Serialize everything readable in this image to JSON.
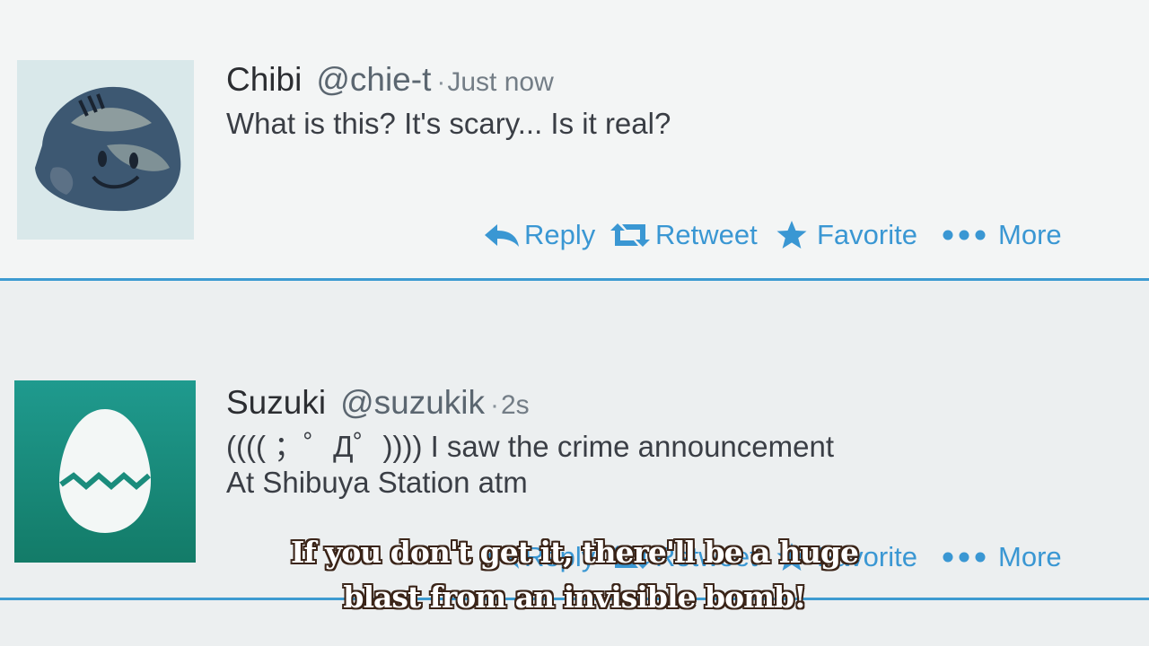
{
  "tweets": [
    {
      "avatar_icon": "rock-face-avatar",
      "name": "Chibi",
      "handle": "@chie-t",
      "separator": "·",
      "time": "Just now",
      "lines": [
        "What is this? It's scary... Is it real?"
      ],
      "actions": {
        "reply": "Reply",
        "retweet": "Retweet",
        "favorite": "Favorite",
        "more": "More"
      }
    },
    {
      "avatar_icon": "egg-avatar",
      "name": "Suzuki",
      "handle": "@suzukik",
      "separator": "·",
      "time": "2s",
      "lines": [
        "(((( ；゜Д゜)))) I saw the crime announcement",
        "At Shibuya Station atm"
      ],
      "actions": {
        "reply": "Reply",
        "retweet": "Retweet",
        "favorite": "Favorite",
        "more": "More"
      }
    }
  ],
  "subtitles": [
    "If you don't get it, there'll be a huge",
    "blast from an invisible bomb!"
  ],
  "colors": {
    "accent": "#3a97d3",
    "divider": "#3d9bd1",
    "egg_avatar_bg": "#1a8c7c"
  }
}
